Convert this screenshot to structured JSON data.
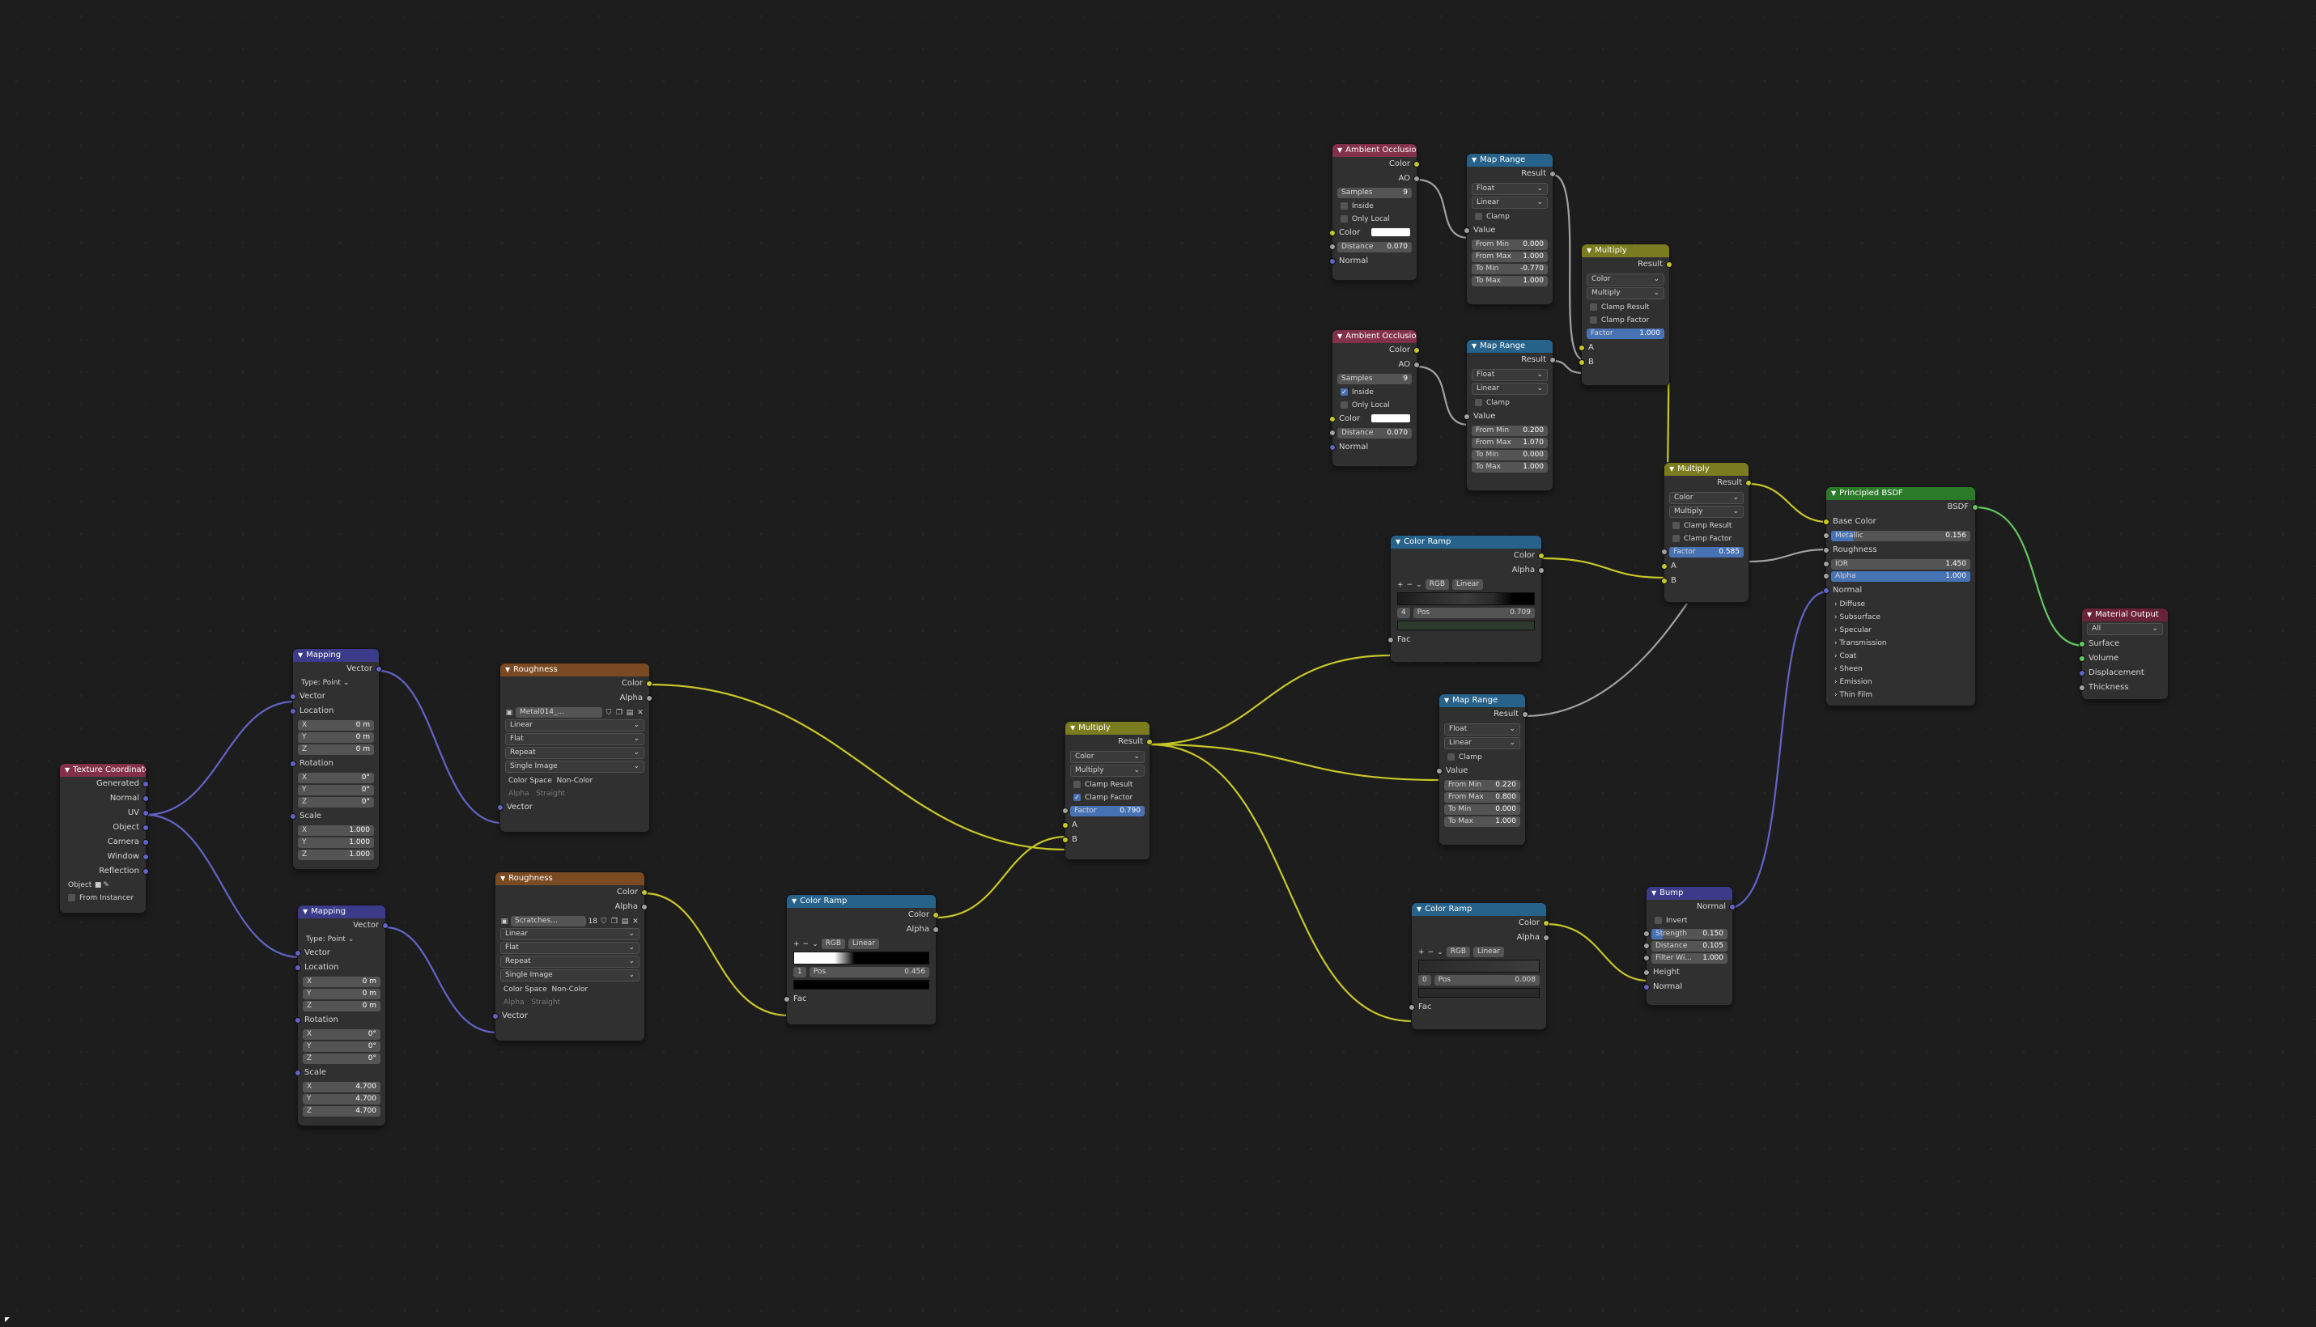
{
  "nodes": {
    "tex_coord": {
      "title": "Texture Coordinate",
      "outputs": [
        "Generated",
        "Normal",
        "UV",
        "Object",
        "Camera",
        "Window",
        "Reflection"
      ],
      "object_label": "Object",
      "from_instancer": "From Instancer"
    },
    "mapping1": {
      "title": "Mapping",
      "out": "Vector",
      "type_label": "Type:",
      "type_value": "Point",
      "vector": "Vector",
      "location": "Location",
      "loc": {
        "x": "0 m",
        "y": "0 m",
        "z": "0 m"
      },
      "rotation": "Rotation",
      "rot": {
        "x": "0°",
        "y": "0°",
        "z": "0°"
      },
      "scale": "Scale",
      "scl": {
        "x": "1.000",
        "y": "1.000",
        "z": "1.000"
      }
    },
    "mapping2": {
      "title": "Mapping",
      "out": "Vector",
      "type_label": "Type:",
      "type_value": "Point",
      "vector": "Vector",
      "location": "Location",
      "loc": {
        "x": "0 m",
        "y": "0 m",
        "z": "0 m"
      },
      "rotation": "Rotation",
      "rot": {
        "x": "0°",
        "y": "0°",
        "z": "0°"
      },
      "scale": "Scale",
      "scl": {
        "x": "4.700",
        "y": "4.700",
        "z": "4.700"
      }
    },
    "rough1": {
      "title": "Roughness",
      "out_color": "Color",
      "out_alpha": "Alpha",
      "image": "Metal014_...",
      "interp": "Linear",
      "proj": "Flat",
      "ext": "Repeat",
      "src": "Single Image",
      "cs_label": "Color Space",
      "cs_value": "Non-Color",
      "alpha_label": "Alpha",
      "alpha_value": "Straight",
      "vector": "Vector"
    },
    "rough2": {
      "title": "Roughness",
      "out_color": "Color",
      "out_alpha": "Alpha",
      "image": "Scratches...",
      "users": "18",
      "interp": "Linear",
      "proj": "Flat",
      "ext": "Repeat",
      "src": "Single Image",
      "cs_label": "Color Space",
      "cs_value": "Non-Color",
      "alpha_label": "Alpha",
      "alpha_value": "Straight",
      "vector": "Vector"
    },
    "ramp1": {
      "title": "Color Ramp",
      "out_color": "Color",
      "out_alpha": "Alpha",
      "mode": "RGB",
      "interp": "Linear",
      "index": "1",
      "pos_label": "Pos",
      "pos": "0.456",
      "fac": "Fac"
    },
    "multiply1": {
      "title": "Multiply",
      "result": "Result",
      "type": "Color",
      "op": "Multiply",
      "clamp_result": "Clamp Result",
      "clamp_factor": "Clamp Factor",
      "factor_label": "Factor",
      "factor": "0.790",
      "a": "A",
      "b": "B"
    },
    "ao1": {
      "title": "Ambient Occlusion",
      "out_color": "Color",
      "out_ao": "AO",
      "samples_label": "Samples",
      "samples": "9",
      "inside": "Inside",
      "only_local": "Only Local",
      "color": "Color",
      "distance_label": "Distance",
      "distance": "0.070",
      "normal": "Normal"
    },
    "ao2": {
      "title": "Ambient Occlusion",
      "out_color": "Color",
      "out_ao": "AO",
      "samples_label": "Samples",
      "samples": "9",
      "inside": "Inside",
      "only_local": "Only Local",
      "color": "Color",
      "distance_label": "Distance",
      "distance": "0.070",
      "normal": "Normal"
    },
    "maprange1": {
      "title": "Map Range",
      "result": "Result",
      "type": "Float",
      "interp": "Linear",
      "clamp": "Clamp",
      "value": "Value",
      "from_min": "0.000",
      "from_max": "1.000",
      "to_min": "-0.770",
      "to_max": "1.000"
    },
    "maprange2": {
      "title": "Map Range",
      "result": "Result",
      "type": "Float",
      "interp": "Linear",
      "clamp": "Clamp",
      "value": "Value",
      "from_min": "0.200",
      "from_max": "1.070",
      "to_min": "0.000",
      "to_max": "1.000"
    },
    "maprange3": {
      "title": "Map Range",
      "result": "Result",
      "type": "Float",
      "interp": "Linear",
      "clamp": "Clamp",
      "value": "Value",
      "from_min": "0.220",
      "from_max": "0.800",
      "to_min": "0.000",
      "to_max": "1.000"
    },
    "multiply2": {
      "title": "Multiply",
      "result": "Result",
      "type": "Color",
      "op": "Multiply",
      "clamp_result": "Clamp Result",
      "clamp_factor": "Clamp Factor",
      "factor_label": "Factor",
      "factor": "1.000",
      "a": "A",
      "b": "B"
    },
    "multiply3": {
      "title": "Multiply",
      "result": "Result",
      "type": "Color",
      "op": "Multiply",
      "clamp_result": "Clamp Result",
      "clamp_factor": "Clamp Factor",
      "factor_label": "Factor",
      "factor": "0.585",
      "a": "A",
      "b": "B"
    },
    "ramp2": {
      "title": "Color Ramp",
      "out_color": "Color",
      "out_alpha": "Alpha",
      "mode": "RGB",
      "interp": "Linear",
      "index": "4",
      "pos_label": "Pos",
      "pos": "0.709",
      "fac": "Fac"
    },
    "ramp3": {
      "title": "Color Ramp",
      "out_color": "Color",
      "out_alpha": "Alpha",
      "mode": "RGB",
      "interp": "Linear",
      "index": "0",
      "pos_label": "Pos",
      "pos": "0.008",
      "fac": "Fac"
    },
    "bump": {
      "title": "Bump",
      "out": "Normal",
      "invert": "Invert",
      "strength_label": "Strength",
      "strength": "0.150",
      "distance_label": "Distance",
      "distance": "0.105",
      "filter_label": "Filter Wi...",
      "filter": "1.000",
      "height": "Height",
      "normal": "Normal"
    },
    "bsdf": {
      "title": "Principled BSDF",
      "out": "BSDF",
      "base_color": "Base Color",
      "metallic_label": "Metallic",
      "metallic": "0.156",
      "roughness": "Roughness",
      "ior_label": "IOR",
      "ior": "1.450",
      "alpha_label": "Alpha",
      "alpha": "1.000",
      "normal": "Normal",
      "panels": [
        "Diffuse",
        "Subsurface",
        "Specular",
        "Transmission",
        "Coat",
        "Sheen",
        "Emission",
        "Thin Film"
      ]
    },
    "output": {
      "title": "Material Output",
      "target": "All",
      "inputs": [
        "Surface",
        "Volume",
        "Displacement",
        "Thickness"
      ]
    }
  },
  "colors": {
    "bg": "#1d1d1d",
    "node": "#303030",
    "wire_color": "#c7c729",
    "wire_float": "#a1a1a1",
    "wire_vector": "#6363c7",
    "wire_shader": "#63c763"
  }
}
